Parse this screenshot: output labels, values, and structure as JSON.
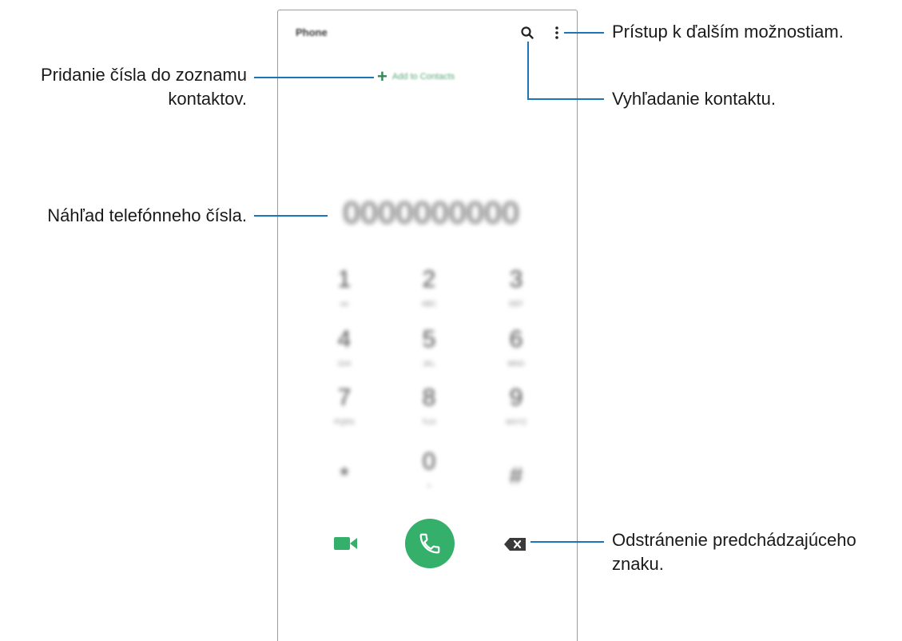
{
  "phone": {
    "title": "Phone",
    "add_contacts_plus": "+",
    "add_contacts_label": "Add to Contacts",
    "number_preview": "0000000000",
    "keypad": [
      {
        "digit": "1",
        "letters": "oo"
      },
      {
        "digit": "2",
        "letters": "ABC"
      },
      {
        "digit": "3",
        "letters": "DEF"
      },
      {
        "digit": "4",
        "letters": "GHI"
      },
      {
        "digit": "5",
        "letters": "JKL"
      },
      {
        "digit": "6",
        "letters": "MNO"
      },
      {
        "digit": "7",
        "letters": "PQRS"
      },
      {
        "digit": "8",
        "letters": "TUV"
      },
      {
        "digit": "9",
        "letters": "WXYZ"
      },
      {
        "digit": "*",
        "letters": ""
      },
      {
        "digit": "0",
        "letters": "+"
      },
      {
        "digit": "#",
        "letters": ""
      }
    ],
    "accent_color": "#34b06a"
  },
  "callouts": {
    "more_options": "Prístup k ďalším možnostiam.",
    "search_contact": "Vyhľadanie kontaktu.",
    "add_contact_line1": "Pridanie čísla do zoznamu",
    "add_contact_line2": "kontaktov.",
    "number_preview": "Náhľad telefónneho čísla.",
    "delete_line1": "Odstránenie predchádzajúceho",
    "delete_line2": "znaku.",
    "line_color": "#1b75bb"
  },
  "icons": {
    "search": "search-icon",
    "more": "more-options-icon",
    "video": "video-call-icon",
    "call": "phone-call-icon",
    "backspace": "backspace-icon"
  }
}
